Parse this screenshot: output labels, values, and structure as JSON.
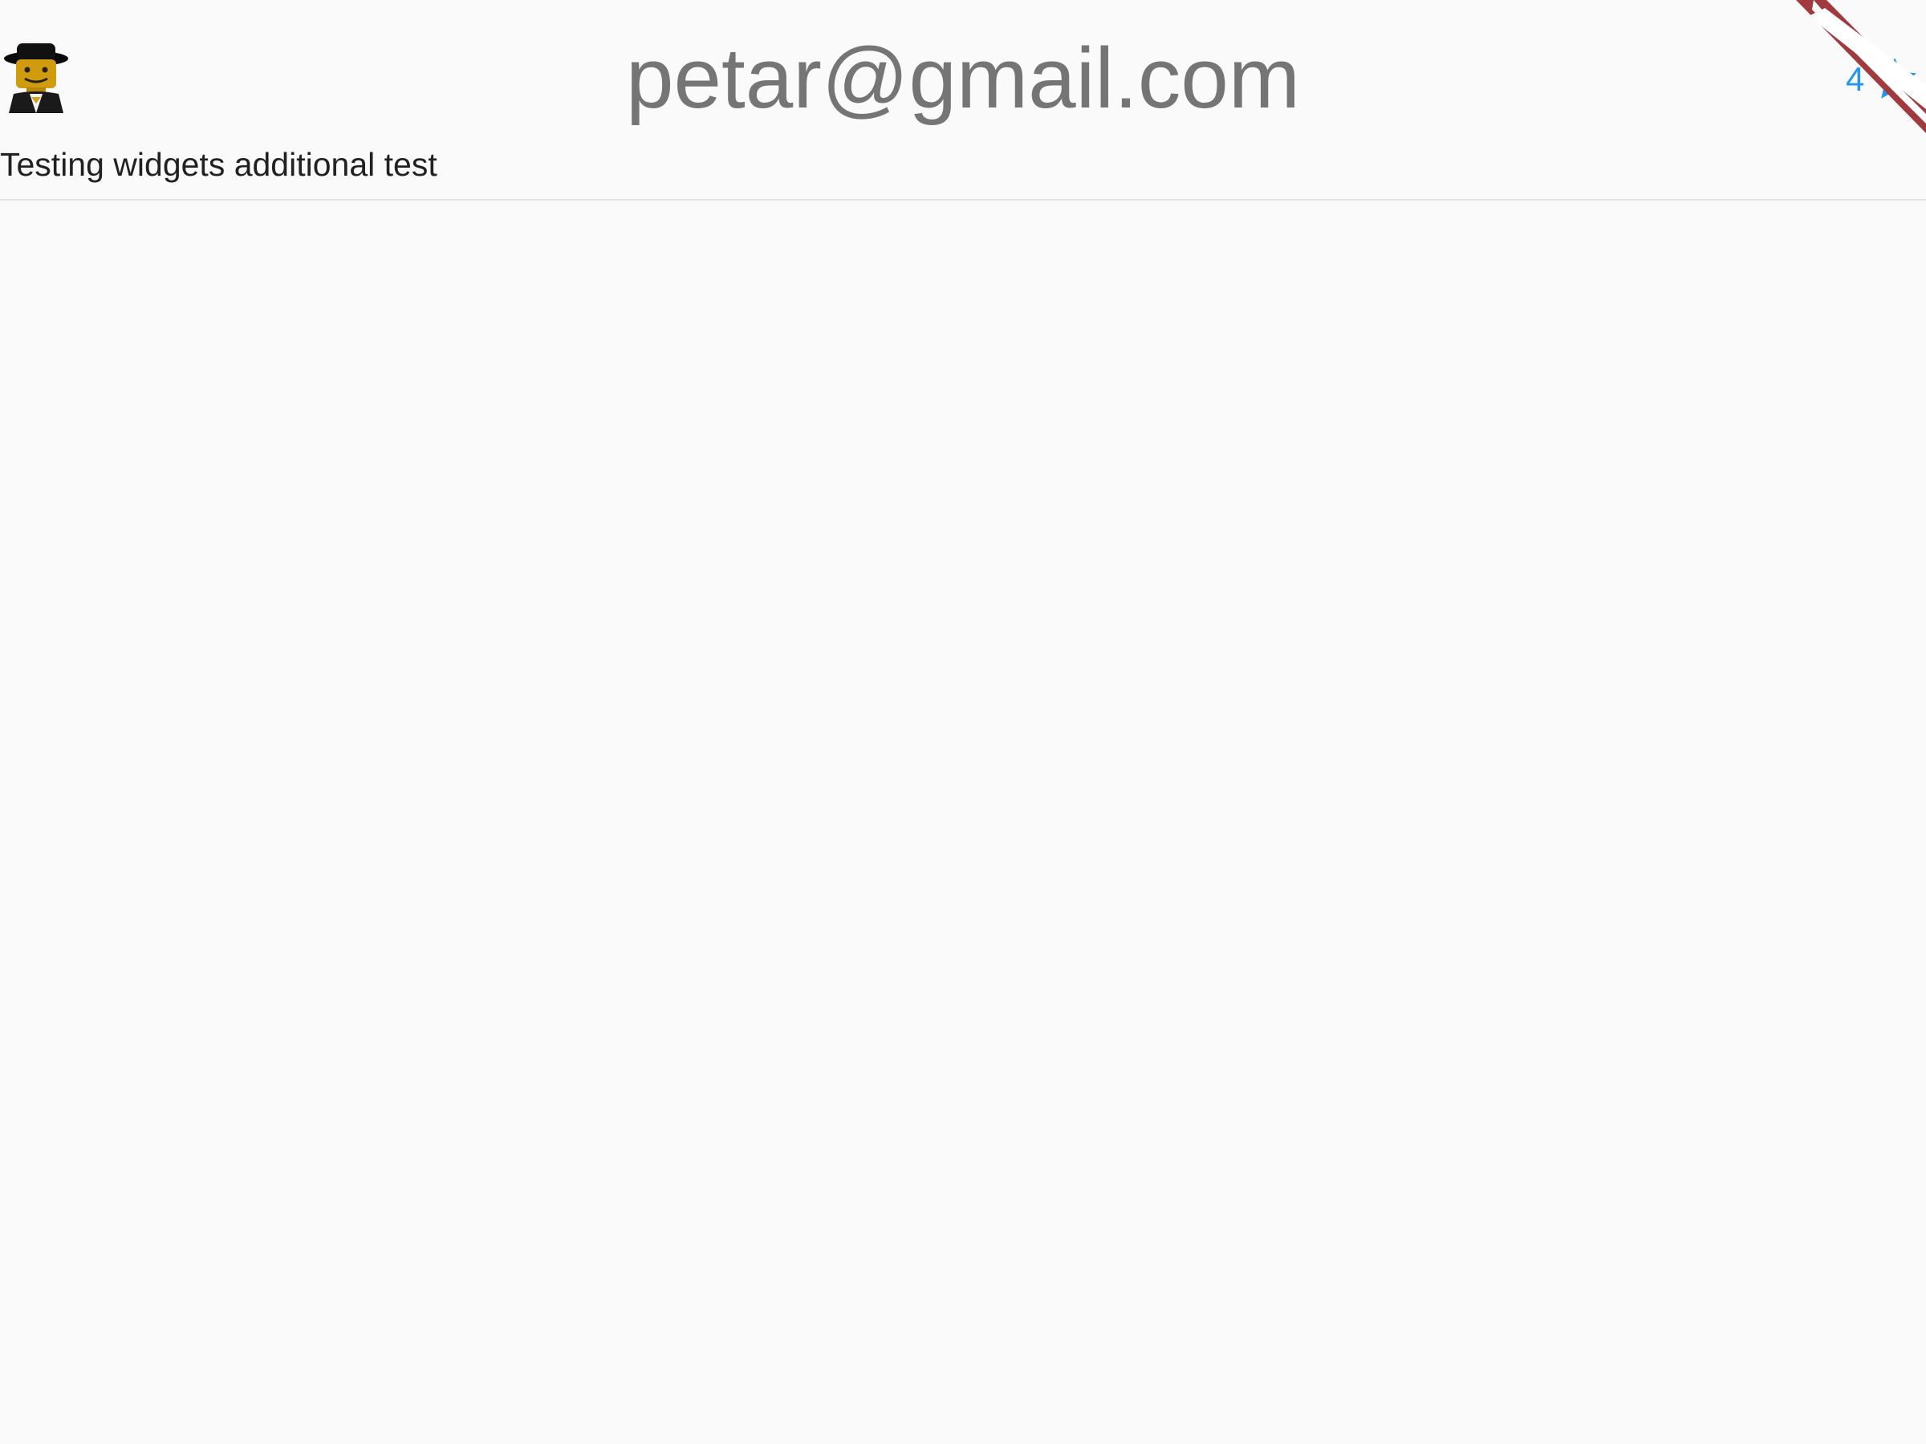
{
  "header": {
    "email": "petar@gmail.com",
    "subtitle": "Testing widgets additional test",
    "avatar_icon": "lego-figure-avatar-icon",
    "rating": {
      "count": "4",
      "icon": "star-icon",
      "color": "#2196f3"
    }
  },
  "debug_banner": {
    "icon": "debug-banner-ribbon",
    "color": "#a13a3f"
  },
  "colors": {
    "background": "#fafafa",
    "title_text": "#757575",
    "subtitle_text": "#212121",
    "divider": "#e2e2e2"
  }
}
